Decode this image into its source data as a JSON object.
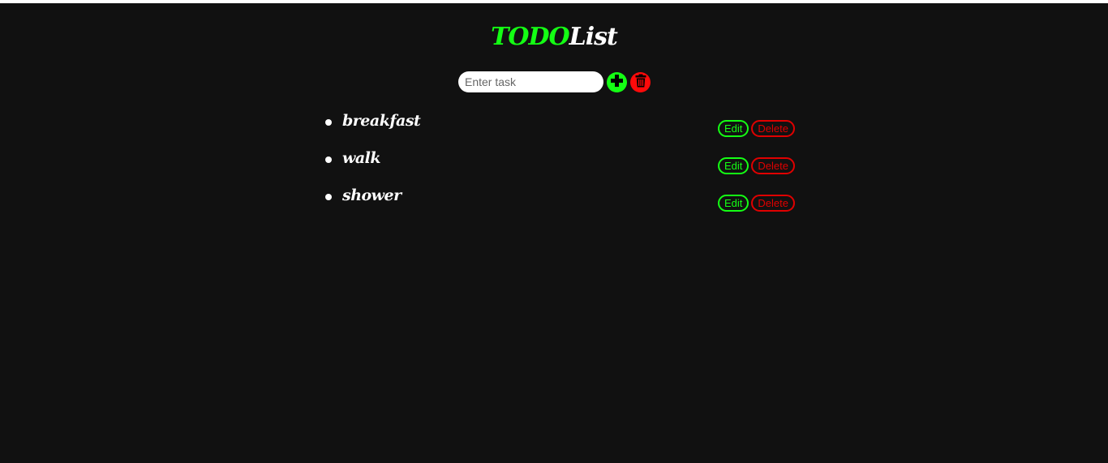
{
  "header": {
    "title_part1": "TODO",
    "title_part2": "List"
  },
  "input": {
    "placeholder": "Enter task",
    "value": ""
  },
  "icons": {
    "add": "plus-icon",
    "clear": "trash-icon"
  },
  "tasks": [
    {
      "text": "breakfast",
      "edit_label": "Edit",
      "delete_label": "Delete"
    },
    {
      "text": "walk",
      "edit_label": "Edit",
      "delete_label": "Delete"
    },
    {
      "text": "shower",
      "edit_label": "Edit",
      "delete_label": "Delete"
    }
  ],
  "colors": {
    "background": "#111111",
    "accent_green": "#14ff14",
    "accent_red": "#e00000",
    "text": "#ffffff"
  }
}
